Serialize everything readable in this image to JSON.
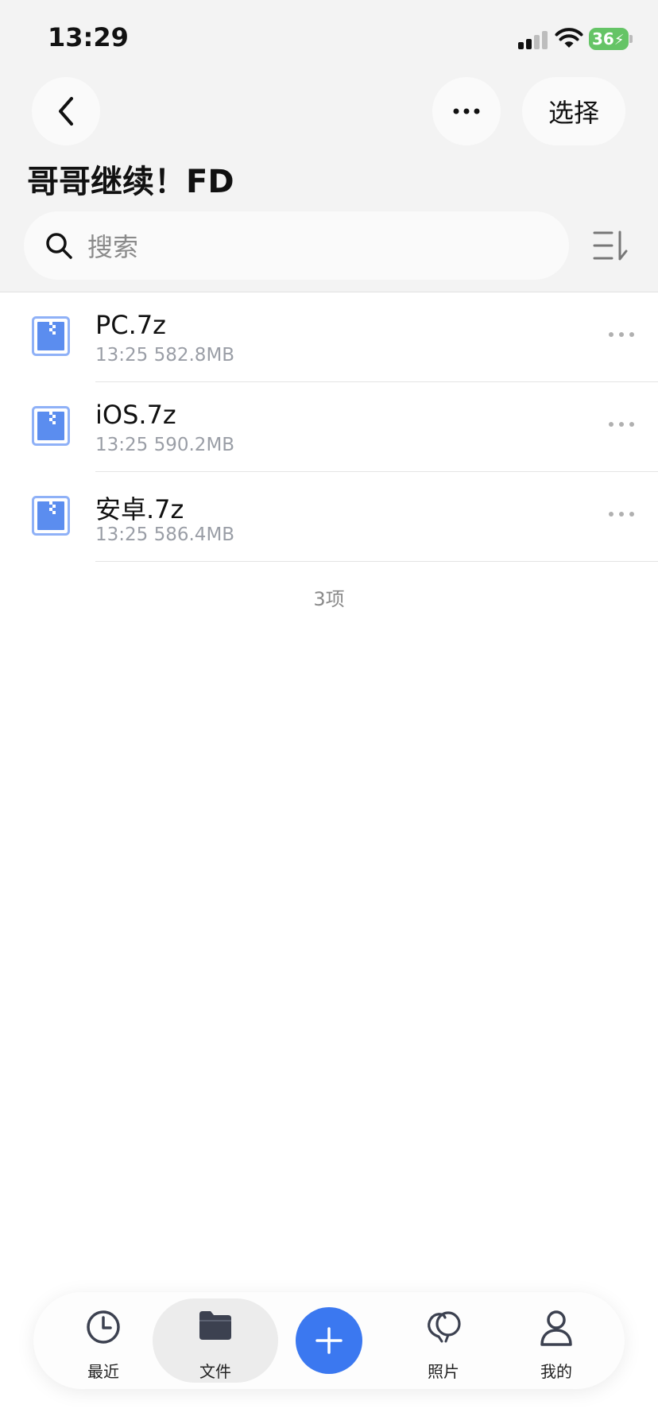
{
  "status_bar": {
    "time": "13:29",
    "battery": "36"
  },
  "nav": {
    "select_label": "选择"
  },
  "page": {
    "title": "哥哥继续！FD"
  },
  "search": {
    "placeholder": "搜索"
  },
  "files": [
    {
      "name": "PC.7z",
      "meta": "13:25 582.8MB"
    },
    {
      "name": "iOS.7z",
      "meta": "13:25 590.2MB"
    },
    {
      "name": "安卓.7z",
      "meta": "13:25 586.4MB"
    }
  ],
  "item_count": "3项",
  "tabs": {
    "recent": "最近",
    "files": "文件",
    "photos": "照片",
    "mine": "我的"
  },
  "colors": {
    "accent": "#3b78f0",
    "battery": "#65c466",
    "file_icon": "#5b8def"
  },
  "icons": {
    "back": "chevron-left-icon",
    "more": "more-horizontal-icon",
    "search": "search-icon",
    "sort": "sort-icon",
    "file": "archive-file-icon",
    "recent": "clock-icon",
    "files": "folder-icon",
    "add": "plus-icon",
    "photos": "balloon-icon",
    "mine": "user-icon"
  }
}
